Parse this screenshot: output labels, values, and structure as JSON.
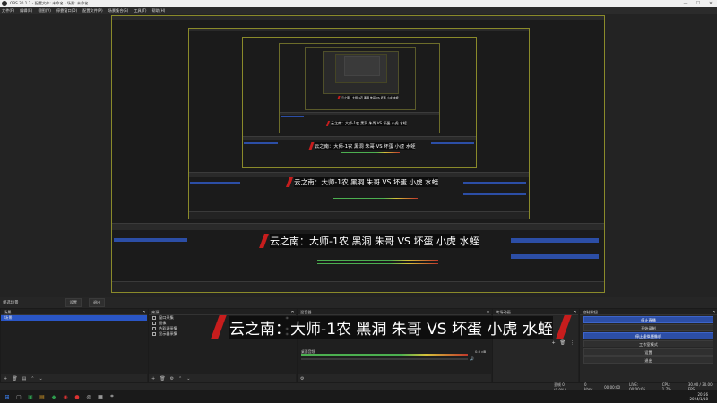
{
  "window": {
    "title": "OBS 30.1.2 - 配置文件: 未命名 - 场景: 未命名",
    "controls": [
      "—",
      "☐",
      "✕"
    ]
  },
  "menu": [
    "文件(F)",
    "编辑(E)",
    "视图(V)",
    "停靠窗口(D)",
    "配置文件(P)",
    "场景集合(S)",
    "工具(T)",
    "帮助(H)"
  ],
  "banner_text": "云之南：大师-1农 黑洞 朱哥 VS 坏蛋 小虎 水蛭",
  "scene_bar": {
    "label": "单选场景",
    "btn_settings": "设置",
    "btn_exit": "退出"
  },
  "docks": {
    "scenes": {
      "title": "场景",
      "items": [
        "场景"
      ]
    },
    "sources": {
      "title": "来源",
      "items": [
        "窗口采集",
        "图像",
        "色彩源采集",
        "显示器采集"
      ]
    },
    "mixer": {
      "title": "混音器",
      "desktop_label": "桌面音频",
      "desktop_db": "0.0 dB",
      "mic_label": "麦克风/Aux",
      "mic_db": "0.0 dB"
    },
    "transitions": {
      "title": "转场动画"
    },
    "controls": {
      "title": "控制按钮",
      "buttons": [
        "停止直播",
        "开始录制",
        "停止虚拟摄像机",
        "工作室模式",
        "设置",
        "退出"
      ]
    }
  },
  "status": {
    "dropped": "丢帧 0 (0.0%)",
    "bitrate": "0 kbps",
    "rec_time": "00:00:00",
    "live": "LIVE: 00:00:05",
    "cpu": "CPU: 1.7%",
    "fps": "30.00 / 30.00 FPS"
  },
  "clock": {
    "time": "20:56",
    "date": "2024/1/18"
  },
  "colors": {
    "accent_blue": "#2c4ea6",
    "banner_red": "#c71d1d",
    "frame_border": "#8a8a2a"
  }
}
